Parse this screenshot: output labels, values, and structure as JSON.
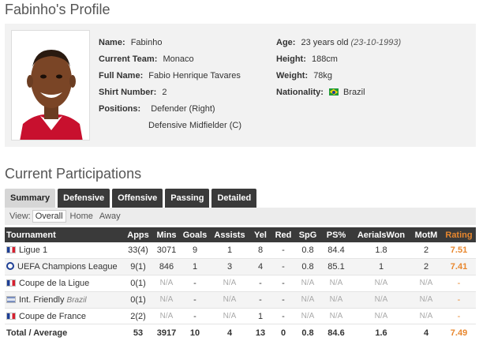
{
  "page_title": "Fabinho's Profile",
  "profile": {
    "photo_icon": "player-photo",
    "name_label": "Name:",
    "name_value": "Fabinho",
    "team_label": "Current Team:",
    "team_value": "Monaco",
    "fullname_label": "Full Name:",
    "fullname_value": "Fabio Henrique Tavares",
    "shirt_label": "Shirt Number:",
    "shirt_value": "2",
    "positions_label": "Positions:",
    "position_1": "Defender (Right)",
    "position_2": "Defensive Midfielder (C)",
    "age_label": "Age:",
    "age_value": "23 years old",
    "dob_value": "(23-10-1993)",
    "height_label": "Height:",
    "height_value": "188cm",
    "weight_label": "Weight:",
    "weight_value": "78kg",
    "nationality_label": "Nationality:",
    "nationality_value": "Brazil"
  },
  "section_title": "Current Participations",
  "tabs": [
    {
      "label": "Summary",
      "active": true
    },
    {
      "label": "Defensive",
      "active": false
    },
    {
      "label": "Offensive",
      "active": false
    },
    {
      "label": "Passing",
      "active": false
    },
    {
      "label": "Detailed",
      "active": false
    }
  ],
  "view": {
    "label": "View:",
    "options": [
      "Overall",
      "Home",
      "Away"
    ],
    "selected": "Overall"
  },
  "table": {
    "headers": [
      "Tournament",
      "Apps",
      "Mins",
      "Goals",
      "Assists",
      "Yel",
      "Red",
      "SpG",
      "PS%",
      "AerialsWon",
      "MotM",
      "Rating"
    ],
    "rows": [
      {
        "flag": "france-flag-icon",
        "tournament": "Ligue 1",
        "sub": "",
        "apps": "33(4)",
        "mins": "3071",
        "goals": "9",
        "assists": "1",
        "yel": "8",
        "red": "-",
        "spg": "0.8",
        "ps": "84.4",
        "aerials": "1.8",
        "motm": "2",
        "rating": "7.51"
      },
      {
        "flag": "champions-league-icon",
        "tournament": "UEFA Champions League",
        "sub": "",
        "apps": "9(1)",
        "mins": "846",
        "goals": "1",
        "assists": "3",
        "yel": "4",
        "red": "-",
        "spg": "0.8",
        "ps": "85.1",
        "aerials": "1",
        "motm": "2",
        "rating": "7.41"
      },
      {
        "flag": "france-flag-icon",
        "tournament": "Coupe de la Ligue",
        "sub": "",
        "apps": "0(1)",
        "mins": "N/A",
        "goals": "-",
        "assists": "N/A",
        "yel": "-",
        "red": "-",
        "spg": "N/A",
        "ps": "N/A",
        "aerials": "N/A",
        "motm": "N/A",
        "rating": "-"
      },
      {
        "flag": "international-flag-icon",
        "tournament": "Int. Friendly",
        "sub": "Brazil",
        "apps": "0(1)",
        "mins": "N/A",
        "goals": "-",
        "assists": "N/A",
        "yel": "-",
        "red": "-",
        "spg": "N/A",
        "ps": "N/A",
        "aerials": "N/A",
        "motm": "N/A",
        "rating": "-"
      },
      {
        "flag": "france-flag-icon",
        "tournament": "Coupe de France",
        "sub": "",
        "apps": "2(2)",
        "mins": "N/A",
        "goals": "-",
        "assists": "N/A",
        "yel": "1",
        "red": "-",
        "spg": "N/A",
        "ps": "N/A",
        "aerials": "N/A",
        "motm": "N/A",
        "rating": "-"
      }
    ],
    "total": {
      "label": "Total / Average",
      "apps": "53",
      "mins": "3917",
      "goals": "10",
      "assists": "4",
      "yel": "13",
      "red": "0",
      "spg": "0.8",
      "ps": "84.6",
      "aerials": "1.6",
      "motm": "4",
      "rating": "7.49"
    }
  },
  "colors": {
    "header_bg": "#3a3a3a",
    "rating": "#e8872e",
    "box_bg": "#f2f2f2"
  }
}
